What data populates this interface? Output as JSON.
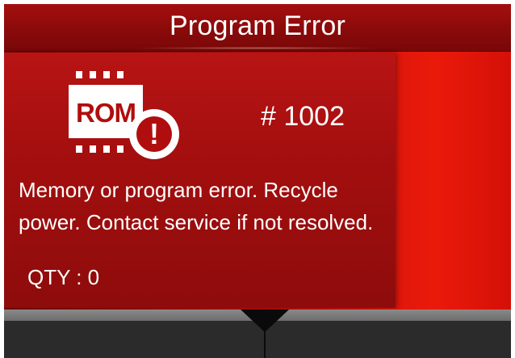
{
  "header": {
    "title": "Program Error"
  },
  "error": {
    "icon_label": "ROM",
    "icon": "rom-chip-alert-icon",
    "code": "# 1002",
    "message": "Memory or program error. Recycle power. Contact service if not resolved.",
    "qty": "QTY : 0"
  },
  "colors": {
    "background_dark": "#7a0707",
    "background_bright": "#ea1a0a",
    "text": "#ffffff",
    "bottom_bar": "#2b2b2b"
  }
}
